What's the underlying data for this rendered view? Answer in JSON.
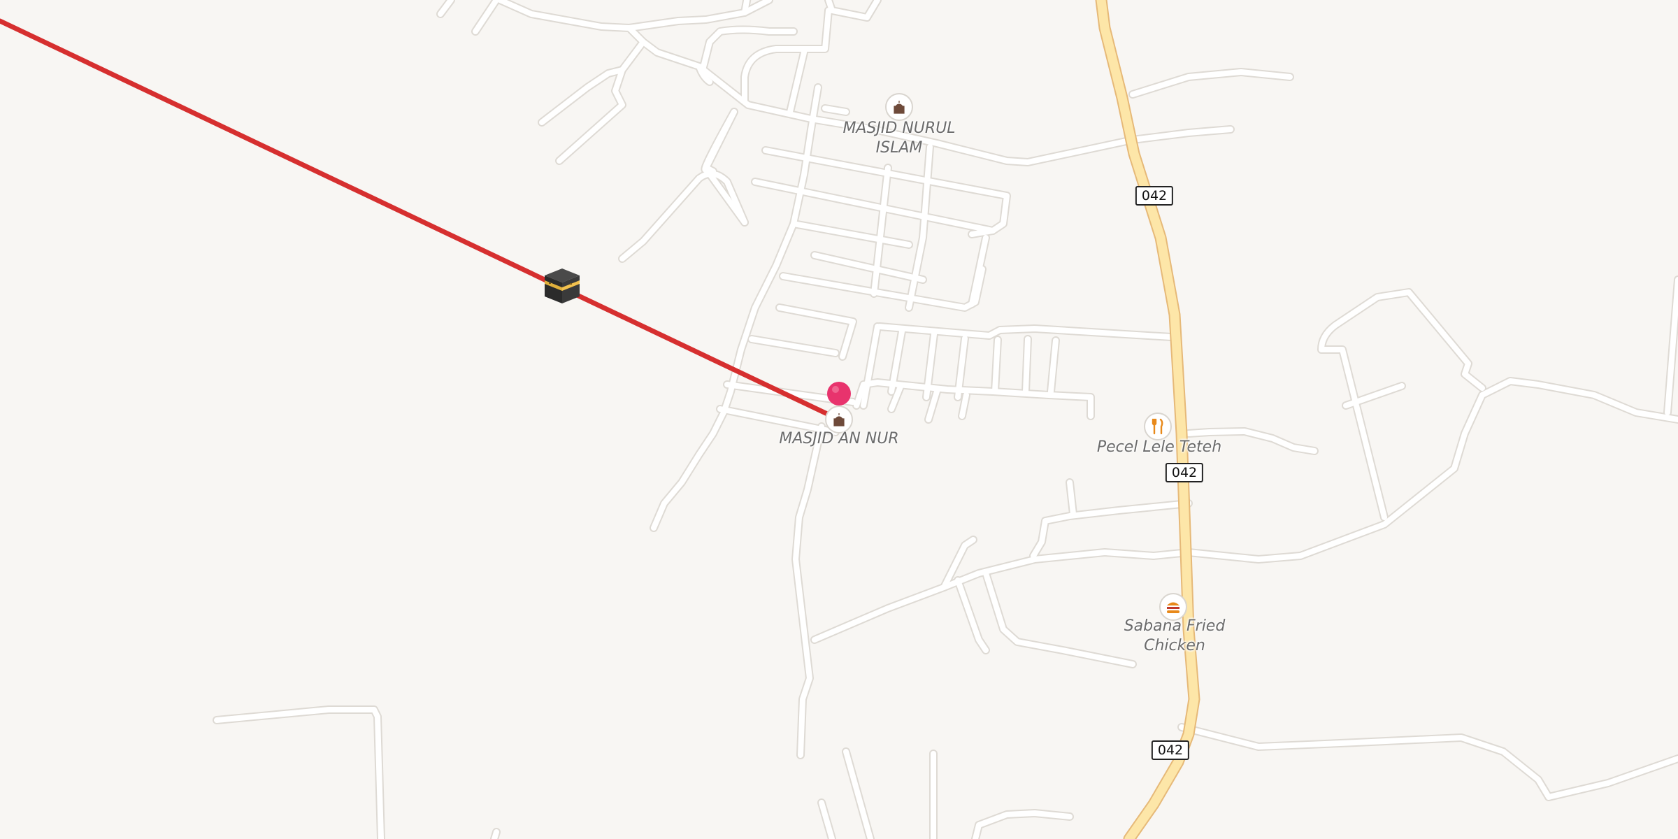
{
  "map": {
    "pois": [
      {
        "id": "masjid-an-nur",
        "label": "MASJID AN NUR",
        "icon": "mosque-icon"
      },
      {
        "id": "masjid-nurul-islam",
        "label": "MASJID NURUL\nISLAM",
        "icon": "mosque-icon"
      },
      {
        "id": "pecel-lele-teteh",
        "label": "Pecel Lele Teteh",
        "icon": "fork-knife-icon"
      },
      {
        "id": "sabana-fried-chicken",
        "label": "Sabana Fried\nChicken",
        "icon": "burger-icon"
      }
    ],
    "road_shields": [
      "042",
      "042",
      "042"
    ],
    "qibla_line_color": "#d62f2f",
    "pin_color": "#e8336d",
    "highway_color": "#fde6a8"
  }
}
